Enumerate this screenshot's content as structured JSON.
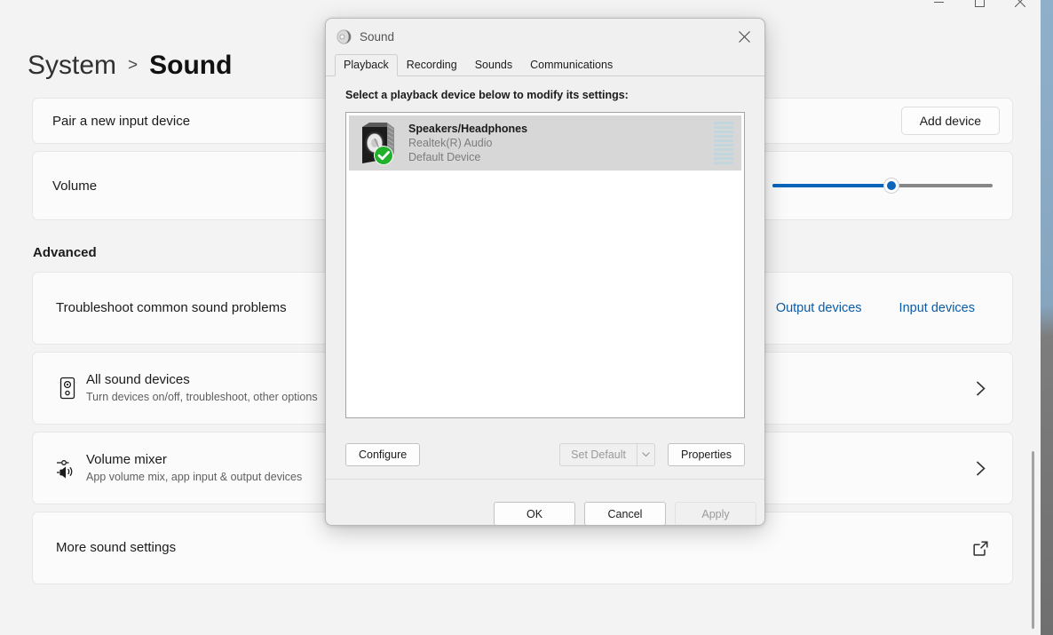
{
  "window": {
    "caption_buttons": [
      {
        "name": "minimize",
        "glyph": "minimize-icon"
      },
      {
        "name": "maximize",
        "glyph": "maximize-icon"
      },
      {
        "name": "close",
        "glyph": "close-icon"
      }
    ]
  },
  "breadcrumb": {
    "parent": "System",
    "separator": ">",
    "current": "Sound"
  },
  "settings": {
    "pair_row": {
      "label": "Pair a new input device",
      "button": "Add device"
    },
    "volume_row": {
      "label": "Volume",
      "slider": {
        "value": 54,
        "min": 0,
        "max": 100,
        "fill_color": "#0a65bb",
        "track_color": "#868686"
      }
    },
    "advanced_heading": "Advanced",
    "advanced_rows": [
      {
        "title": "Troubleshoot common sound problems",
        "subtitle": "",
        "icon": "",
        "links": [
          "Output devices",
          "Input devices"
        ],
        "trailing": ""
      },
      {
        "title": "All sound devices",
        "subtitle": "Turn devices on/off, troubleshoot, other options",
        "icon": "speaker-device-icon",
        "links": [],
        "trailing": "chevron-right-icon"
      },
      {
        "title": "Volume mixer",
        "subtitle": "App volume mix, app input & output devices",
        "icon": "volume-mixer-icon",
        "links": [],
        "trailing": "chevron-right-icon"
      },
      {
        "title": "More sound settings",
        "subtitle": "",
        "icon": "",
        "links": [],
        "trailing": "external-link-icon"
      }
    ]
  },
  "dialog": {
    "title": "Sound",
    "icon": "sound-speaker-icon",
    "close_label": "×",
    "tabs": [
      {
        "label": "Playback",
        "active": true
      },
      {
        "label": "Recording",
        "active": false
      },
      {
        "label": "Sounds",
        "active": false
      },
      {
        "label": "Communications",
        "active": false
      }
    ],
    "prompt": "Select a playback device below to modify its settings:",
    "devices": [
      {
        "name": "Speakers/Headphones",
        "driver": "Realtek(R) Audio",
        "status": "Default Device",
        "selected": true,
        "default_badge": "check-badge-icon",
        "meter_segments": 10
      }
    ],
    "actions": {
      "configure": "Configure",
      "set_default": "Set Default",
      "set_default_enabled": false,
      "properties": "Properties"
    },
    "footer": {
      "ok": "OK",
      "cancel": "Cancel",
      "apply": "Apply",
      "apply_enabled": false
    }
  }
}
